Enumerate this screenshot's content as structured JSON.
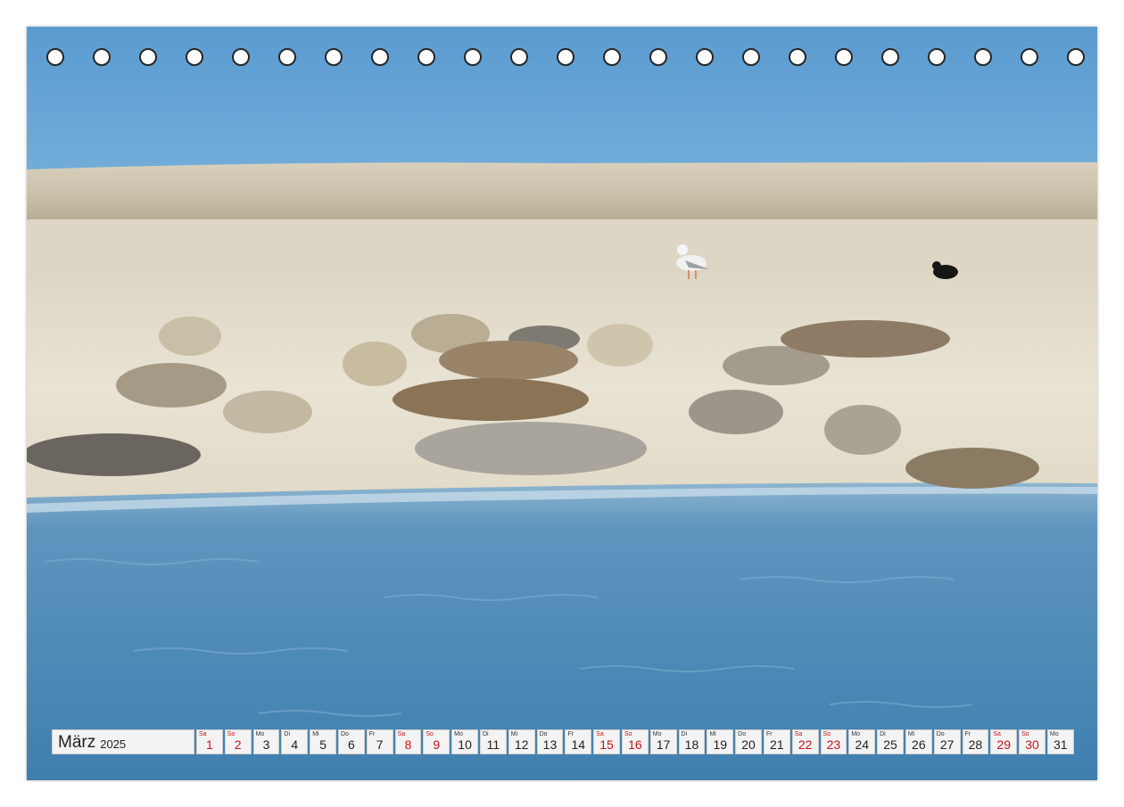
{
  "calendar": {
    "month": "März",
    "year": "2025",
    "days": [
      {
        "dow": "Sa",
        "num": "1",
        "weekend": true
      },
      {
        "dow": "So",
        "num": "2",
        "weekend": true
      },
      {
        "dow": "Mo",
        "num": "3",
        "weekend": false
      },
      {
        "dow": "Di",
        "num": "4",
        "weekend": false
      },
      {
        "dow": "Mi",
        "num": "5",
        "weekend": false
      },
      {
        "dow": "Do",
        "num": "6",
        "weekend": false
      },
      {
        "dow": "Fr",
        "num": "7",
        "weekend": false
      },
      {
        "dow": "Sa",
        "num": "8",
        "weekend": true
      },
      {
        "dow": "So",
        "num": "9",
        "weekend": true
      },
      {
        "dow": "Mo",
        "num": "10",
        "weekend": false
      },
      {
        "dow": "Di",
        "num": "11",
        "weekend": false
      },
      {
        "dow": "Mi",
        "num": "12",
        "weekend": false
      },
      {
        "dow": "Do",
        "num": "13",
        "weekend": false
      },
      {
        "dow": "Fr",
        "num": "14",
        "weekend": false
      },
      {
        "dow": "Sa",
        "num": "15",
        "weekend": true
      },
      {
        "dow": "So",
        "num": "16",
        "weekend": true
      },
      {
        "dow": "Mo",
        "num": "17",
        "weekend": false
      },
      {
        "dow": "Di",
        "num": "18",
        "weekend": false
      },
      {
        "dow": "Mi",
        "num": "19",
        "weekend": false
      },
      {
        "dow": "Do",
        "num": "20",
        "weekend": false
      },
      {
        "dow": "Fr",
        "num": "21",
        "weekend": false
      },
      {
        "dow": "Sa",
        "num": "22",
        "weekend": true
      },
      {
        "dow": "So",
        "num": "23",
        "weekend": true
      },
      {
        "dow": "Mo",
        "num": "24",
        "weekend": false
      },
      {
        "dow": "Di",
        "num": "25",
        "weekend": false
      },
      {
        "dow": "Mi",
        "num": "26",
        "weekend": false
      },
      {
        "dow": "Do",
        "num": "27",
        "weekend": false
      },
      {
        "dow": "Fr",
        "num": "28",
        "weekend": false
      },
      {
        "dow": "Sa",
        "num": "29",
        "weekend": true
      },
      {
        "dow": "So",
        "num": "30",
        "weekend": true
      },
      {
        "dow": "Mo",
        "num": "31",
        "weekend": false
      }
    ]
  },
  "binding": {
    "hole_count": 23
  },
  "colors": {
    "sky": "#5f9fd3",
    "dune": "#cfc6b3",
    "sand": "#e7e1d1",
    "water": "#4e8cb9",
    "weekend": "#c4141c",
    "day_cell": "#f3f3f3"
  },
  "photo": {
    "scene": "seals-on-sandbank-icon"
  }
}
